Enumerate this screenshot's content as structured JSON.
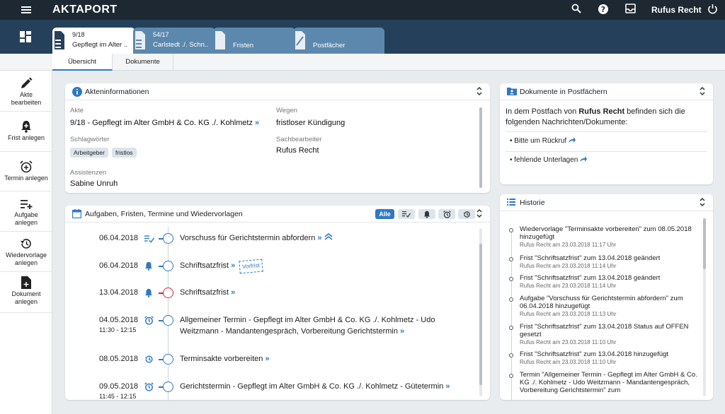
{
  "app": {
    "logo": "AKTAPORT",
    "user": "Rufus Recht"
  },
  "colors": {
    "topbar": "#1d2833",
    "tabbar": "#25405a",
    "inactive_tab": "#5d88ad",
    "accent": "#2f78c4",
    "red": "#d9233a"
  },
  "doc_tabs": [
    {
      "num": "9/18",
      "title": "Gepflegt im Alter ..."
    },
    {
      "num": "54/17",
      "title": "Carlstedt ./. Schn..."
    },
    {
      "num": "",
      "title": "Fristen"
    },
    {
      "num": "",
      "title": "Postfächer"
    }
  ],
  "subtabs": [
    "Übersicht",
    "Dokumente"
  ],
  "sidebar": [
    {
      "label": "Akte bearbeiten",
      "icon": "pencil-icon"
    },
    {
      "label": "Frist anlegen",
      "icon": "bell-plus-icon"
    },
    {
      "label": "Termin anlegen",
      "icon": "alarm-plus-icon"
    },
    {
      "label": "Aufgabe anlegen",
      "icon": "list-plus-icon"
    },
    {
      "label": "Wiedervorlage anlegen",
      "icon": "history-icon"
    },
    {
      "label": "Dokument anlegen",
      "icon": "document-plus-icon"
    }
  ],
  "akten": {
    "title": "Akteninformationen",
    "akte_label": "Akte",
    "akte_value": "9/18 - Gepflegt im Alter GmbH & Co. KG ./. Kohlmetz",
    "wegen_label": "Wegen",
    "wegen_value": "fristloser Kündigung",
    "schlag_label": "Schlagwörter",
    "tags": [
      "Arbeitgeber",
      "fristlos"
    ],
    "sach_label": "Sachbearbeiter",
    "sach_value": "Rufus Recht",
    "assist_label": "Assistenzen",
    "assist_value": "Sabine Unruh"
  },
  "tasks": {
    "title": "Aufgaben, Fristen, Termine und Wiedervorlagen",
    "filter_all": "Alle",
    "vorfrist": "Vorfrist",
    "items": [
      {
        "date": "06.04.2018",
        "time": "",
        "icon": "checklist-icon",
        "text": "Vorschuss für Gerichtstermin abfordern",
        "red": false
      },
      {
        "date": "06.04.2018",
        "time": "",
        "icon": "bell-icon",
        "text": "Schriftsatzfrist",
        "red": false
      },
      {
        "date": "13.04.2018",
        "time": "",
        "icon": "bell-icon",
        "text": "Schriftsatzfrist",
        "red": true
      },
      {
        "date": "04.05.2018",
        "time": "11:30 - 12:15",
        "icon": "alarm-icon",
        "text": "Allgemeiner Termin - Gepflegt im Alter GmbH & Co. KG ./. Kohlmetz - Udo Weitzmann - Mandantengespräch, Vorbereitung Gerichtstermin",
        "red": false
      },
      {
        "date": "08.05.2018",
        "time": "",
        "icon": "history-icon",
        "text": "Terminsakte vorbereiten",
        "red": false
      },
      {
        "date": "09.05.2018",
        "time": "11:45 - 12:15",
        "icon": "alarm-icon",
        "text": "Gerichtstermin - Gepflegt im Alter GmbH & Co. KG ./. Kohlmetz - Gütetermin",
        "red": false
      }
    ]
  },
  "postfach": {
    "title": "Dokumente in Postfächern",
    "intro_pre": "In dem Postfach von ",
    "intro_user": "Rufus Recht",
    "intro_post": " befinden sich die folgenden Nachrichten/Dokumente:",
    "items": [
      "Bitte um Rückruf",
      "fehlende Unterlagen"
    ]
  },
  "historie": {
    "title": "Historie",
    "items": [
      {
        "text": "Wiedervorlage \"Terminsakte vorbereiten\" zum 08.05.2018 hinzugefügt",
        "sub": "Rufus Recht am 23.03.2018 11:17 Uhr"
      },
      {
        "text": "Frist \"Schriftsatzfrist\" zum 13.04.2018 geändert",
        "sub": "Rufus Recht am 23.03.2018 11:14 Uhr"
      },
      {
        "text": "Frist \"Schriftsatzfrist\" zum 13.04.2018 geändert",
        "sub": "Rufus Recht am 23.03.2018 11:14 Uhr"
      },
      {
        "text": "Aufgabe \"Vorschuss für Gerichtstermin abfordern\" zum 06.04.2018 hinzugefügt",
        "sub": "Rufus Recht am 23.03.2018 11:13 Uhr"
      },
      {
        "text": "Frist \"Schriftsatzfrist\" zum 13.04.2018 Status auf OFFEN gesetzt",
        "sub": "Rufus Recht am 23.03.2018 11:10 Uhr"
      },
      {
        "text": "Frist \"Schriftsatzfrist\" zum 13.04.2018 hinzugefügt",
        "sub": "Rufus Recht am 23.03.2018 11:10 Uhr"
      },
      {
        "text": "Termin \"Allgemeiner Termin - Gepflegt im Alter GmbH & Co. KG ./. Kohlmetz - Udo Weitzmann - Mandantengespräch, Vorbereitung Gerichtstermin\" zum",
        "sub": ""
      }
    ]
  }
}
